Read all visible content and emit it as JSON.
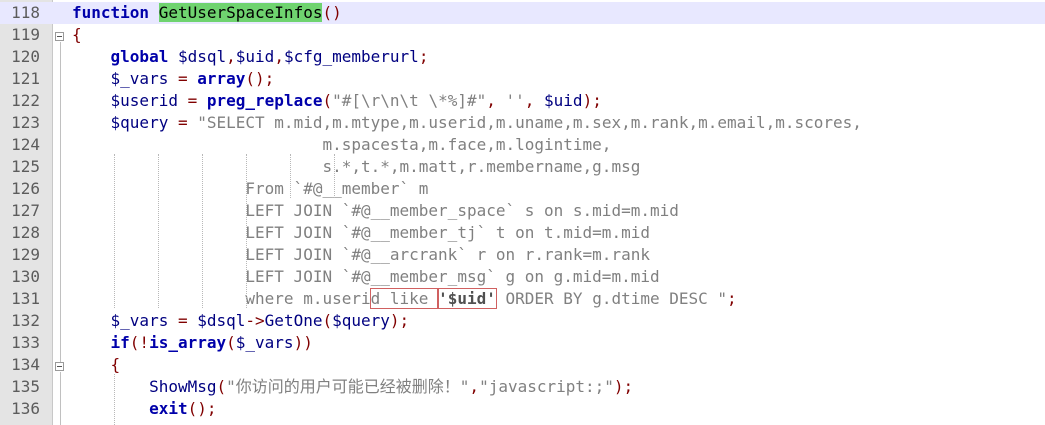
{
  "editor": {
    "lines": [
      {
        "num": "118",
        "tokens": [
          {
            "t": "kw",
            "v": "function "
          },
          {
            "t": "hl",
            "v": "GetUserSpaceInfos"
          },
          {
            "t": "op",
            "v": "()"
          }
        ]
      },
      {
        "num": "119",
        "tokens": [
          {
            "t": "op",
            "v": "{"
          }
        ]
      },
      {
        "num": "120",
        "tokens": [
          {
            "t": "plain",
            "v": "    "
          },
          {
            "t": "kw",
            "v": "global "
          },
          {
            "t": "var",
            "v": "$dsql"
          },
          {
            "t": "op",
            "v": ","
          },
          {
            "t": "var",
            "v": "$uid"
          },
          {
            "t": "op",
            "v": ","
          },
          {
            "t": "var",
            "v": "$cfg_memberurl"
          },
          {
            "t": "op",
            "v": ";"
          }
        ]
      },
      {
        "num": "121",
        "tokens": [
          {
            "t": "plain",
            "v": "    "
          },
          {
            "t": "var",
            "v": "$_vars"
          },
          {
            "t": "op",
            "v": " = "
          },
          {
            "t": "kw",
            "v": "array"
          },
          {
            "t": "op",
            "v": "();"
          }
        ]
      },
      {
        "num": "122",
        "tokens": [
          {
            "t": "plain",
            "v": "    "
          },
          {
            "t": "var",
            "v": "$userid"
          },
          {
            "t": "op",
            "v": " = "
          },
          {
            "t": "kw",
            "v": "preg_replace"
          },
          {
            "t": "op",
            "v": "("
          },
          {
            "t": "str",
            "v": "\"#[\\r\\n\\t \\*%]#\""
          },
          {
            "t": "op",
            "v": ", "
          },
          {
            "t": "str",
            "v": "''"
          },
          {
            "t": "op",
            "v": ", "
          },
          {
            "t": "var",
            "v": "$uid"
          },
          {
            "t": "op",
            "v": ");"
          }
        ]
      },
      {
        "num": "123",
        "tokens": [
          {
            "t": "plain",
            "v": "    "
          },
          {
            "t": "var",
            "v": "$query"
          },
          {
            "t": "op",
            "v": " = "
          },
          {
            "t": "str",
            "v": "\"SELECT m.mid,m.mtype,m.userid,m.uname,m.sex,m.rank,m.email,m.scores,"
          }
        ]
      },
      {
        "num": "124",
        "tokens": [
          {
            "t": "str",
            "v": "                          m.spacesta,m.face,m.logintime,"
          }
        ]
      },
      {
        "num": "125",
        "tokens": [
          {
            "t": "str",
            "v": "                          s.*,t.*,m.matt,r.membername,g.msg"
          }
        ]
      },
      {
        "num": "126",
        "tokens": [
          {
            "t": "str",
            "v": "                  From `#@__member` m"
          }
        ]
      },
      {
        "num": "127",
        "tokens": [
          {
            "t": "str",
            "v": "                  LEFT JOIN `#@__member_space` s on s.mid=m.mid"
          }
        ]
      },
      {
        "num": "128",
        "tokens": [
          {
            "t": "str",
            "v": "                  LEFT JOIN `#@__member_tj` t on t.mid=m.mid"
          }
        ]
      },
      {
        "num": "129",
        "tokens": [
          {
            "t": "str",
            "v": "                  LEFT JOIN `#@__arcrank` r on r.rank=m.rank"
          }
        ]
      },
      {
        "num": "130",
        "tokens": [
          {
            "t": "str",
            "v": "                  LEFT JOIN `#@__member_msg` g on g.mid=m.mid"
          }
        ]
      },
      {
        "num": "131",
        "tokens": [
          {
            "t": "str",
            "v": "                  where m.useri"
          },
          {
            "t": "strbox",
            "v": "d like "
          },
          {
            "t": "strbold",
            "v": "'$uid'"
          },
          {
            "t": "str",
            "v": " ORDER BY g.dtime DESC \""
          },
          {
            "t": "op",
            "v": ";"
          }
        ]
      },
      {
        "num": "132",
        "tokens": [
          {
            "t": "plain",
            "v": "    "
          },
          {
            "t": "var",
            "v": "$_vars"
          },
          {
            "t": "op",
            "v": " = "
          },
          {
            "t": "var",
            "v": "$dsql"
          },
          {
            "t": "op",
            "v": "->"
          },
          {
            "t": "fn",
            "v": "GetOne"
          },
          {
            "t": "op",
            "v": "("
          },
          {
            "t": "var",
            "v": "$query"
          },
          {
            "t": "op",
            "v": ");"
          }
        ]
      },
      {
        "num": "133",
        "tokens": [
          {
            "t": "plain",
            "v": "    "
          },
          {
            "t": "kw",
            "v": "if"
          },
          {
            "t": "op",
            "v": "(!"
          },
          {
            "t": "kw",
            "v": "is_array"
          },
          {
            "t": "op",
            "v": "("
          },
          {
            "t": "var",
            "v": "$_vars"
          },
          {
            "t": "op",
            "v": "))"
          }
        ]
      },
      {
        "num": "134",
        "tokens": [
          {
            "t": "plain",
            "v": "    "
          },
          {
            "t": "op",
            "v": "{"
          }
        ]
      },
      {
        "num": "135",
        "tokens": [
          {
            "t": "plain",
            "v": "        "
          },
          {
            "t": "fn",
            "v": "ShowMsg"
          },
          {
            "t": "op",
            "v": "("
          },
          {
            "t": "str",
            "v": "\"你访问的用户可能已经被删除！\""
          },
          {
            "t": "op",
            "v": ","
          },
          {
            "t": "str",
            "v": "\"javascript:;\""
          },
          {
            "t": "op",
            "v": ");"
          }
        ]
      },
      {
        "num": "136",
        "tokens": [
          {
            "t": "plain",
            "v": "        "
          },
          {
            "t": "kw",
            "v": "exit"
          },
          {
            "t": "op",
            "v": "();"
          }
        ]
      }
    ]
  }
}
